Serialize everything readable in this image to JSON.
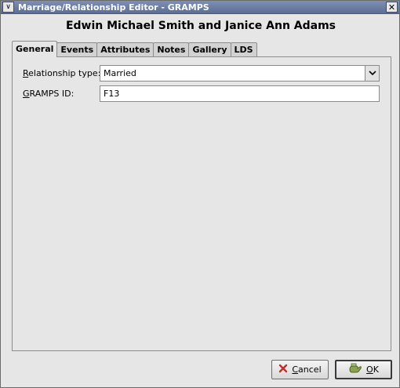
{
  "window": {
    "title": "Marriage/Relationship Editor - GRAMPS",
    "menu_glyph": "∨",
    "close_glyph": "✕"
  },
  "heading": "Edwin Michael Smith and Janice Ann Adams",
  "tabs": [
    {
      "label": "General",
      "active": true
    },
    {
      "label": "Events"
    },
    {
      "label": "Attributes"
    },
    {
      "label": "Notes"
    },
    {
      "label": "Gallery"
    },
    {
      "label": "LDS"
    }
  ],
  "general": {
    "relationship_type": {
      "label_first": "R",
      "label_rest": "elationship type:",
      "value": "Married"
    },
    "gramps_id": {
      "label_first": "G",
      "label_rest": "RAMPS ID:",
      "value": "F13"
    }
  },
  "buttons": {
    "cancel": {
      "label_first": "C",
      "label_rest": "ancel",
      "icon": "cancel-x-icon"
    },
    "ok": {
      "label_first": "O",
      "label_rest": "K",
      "icon": "ok-hand-icon"
    }
  },
  "colors": {
    "titlebar": "#6a7ca0",
    "cancel_icon": "#c0302a",
    "ok_icon": "#6b8a3a"
  }
}
